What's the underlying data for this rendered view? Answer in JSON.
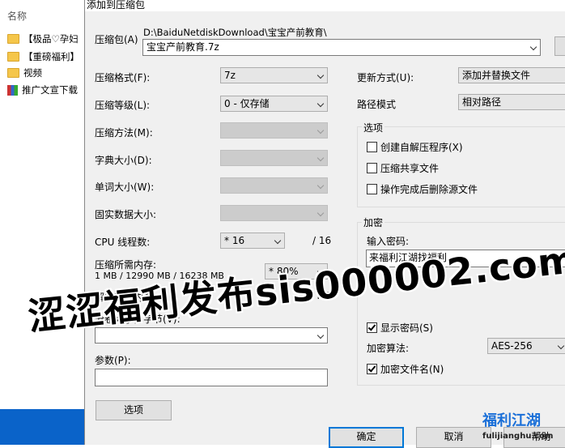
{
  "explorer": {
    "header": "名称",
    "rows": [
      {
        "type": "folder",
        "label": "【极品♡孕妇"
      },
      {
        "type": "folder",
        "label": "【重磅福利】"
      },
      {
        "type": "folder",
        "label": "视频"
      },
      {
        "type": "archive",
        "label": "推广文宣下载"
      }
    ]
  },
  "dialog": {
    "title": "添加到压缩包",
    "archive_label": "压缩包(A)",
    "archive_path": "D:\\BaiduNetdiskDownload\\宝宝产前教育\\",
    "archive_name": "宝宝产前教育.7z",
    "format_label": "压缩格式(F):",
    "format_value": "7z",
    "level_label": "压缩等级(L):",
    "level_value": "0 - 仅存储",
    "method_label": "压缩方法(M):",
    "dict_label": "字典大小(D):",
    "word_label": "单词大小(W):",
    "solid_label": "固实数据大小:",
    "cpu_label": "CPU 线程数:",
    "cpu_value": "* 16",
    "cpu_total": "/ 16",
    "mem_comp_label": "压缩所需内存:",
    "mem_comp_value": "1 MB / 12990 MB / 16238 MB",
    "mem_pct": "* 80%",
    "mem_decomp_label": "解压所需内存:",
    "mem_decomp_value": "1 MB",
    "split_label": "分卷大小，字节(V):",
    "params_label": "参数(P):",
    "options_button": "选项",
    "update_label": "更新方式(U):",
    "update_value": "添加并替换文件",
    "path_label": "路径模式",
    "path_value": "相对路径",
    "options_group": "选项",
    "opt_sfx": "创建自解压程序(X)",
    "opt_shared": "压缩共享文件",
    "opt_delete": "操作完成后删除源文件",
    "enc_group": "加密",
    "password_label": "输入密码:",
    "password_value": "来福利江湖找福利",
    "show_password": "显示密码(S)",
    "enc_method_label": "加密算法:",
    "enc_method_value": "AES-256",
    "enc_names": "加密文件名(N)",
    "ok": "确定",
    "cancel": "取消",
    "help": "帮助"
  },
  "watermark": {
    "text": "涩涩福利发布sis000002.com",
    "logo_title": "福利江湖",
    "logo_url": "fulijianghu.com"
  },
  "colors": {
    "accent": "#0078d7",
    "taskbar": "#0a63c9",
    "logo": "#1a6fd8"
  }
}
